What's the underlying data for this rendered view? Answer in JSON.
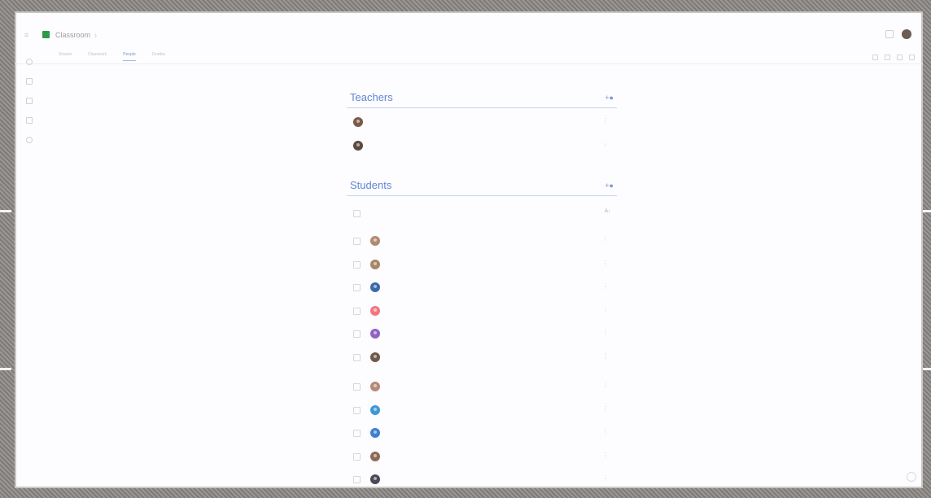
{
  "app": {
    "name": "Classroom",
    "class_name": "",
    "tabs": [
      {
        "label": "Stream"
      },
      {
        "label": "Classwork"
      },
      {
        "label": "People"
      },
      {
        "label": "Grades"
      }
    ],
    "active_tab": "People"
  },
  "teachers": {
    "title": "Teachers",
    "items": [
      {
        "name": "",
        "avatar_color": "#7a5a48"
      },
      {
        "name": "",
        "avatar_color": "#5a4a42"
      }
    ]
  },
  "students": {
    "title": "Students",
    "count_label": "",
    "actions_label": "",
    "items": [
      {
        "name": "",
        "avatar_color": "#b08a72"
      },
      {
        "name": "",
        "avatar_color": "#a88668"
      },
      {
        "name": "",
        "avatar_color": "#3a6aa8"
      },
      {
        "name": "",
        "avatar_color": "#f07880"
      },
      {
        "name": "",
        "avatar_color": "#8e63c4"
      },
      {
        "name": "",
        "avatar_color": "#6e5a4a"
      },
      {
        "name": "",
        "avatar_color": "#b48a7a"
      },
      {
        "name": "",
        "avatar_color": "#3e98d6"
      },
      {
        "name": "",
        "avatar_color": "#3f7fd0"
      },
      {
        "name": "",
        "avatar_color": "#8a6a58"
      },
      {
        "name": "",
        "avatar_color": "#4a4a58"
      }
    ]
  },
  "icons": {
    "menu": "menu-icon",
    "add_person": "add-person-icon",
    "more": "more-vert-icon",
    "sort": "sort-icon"
  },
  "colors": {
    "accent": "#5f87d6",
    "brand_green": "#2e9b4a"
  }
}
